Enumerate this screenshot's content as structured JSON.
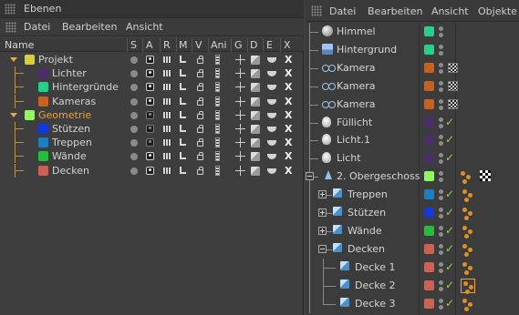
{
  "layers_window": {
    "title": "Ebenen",
    "menu": [
      "Datei",
      "Bearbeiten",
      "Ansicht"
    ],
    "columns": [
      "Name",
      "S",
      "A",
      "R",
      "M",
      "V",
      "Ani",
      "G",
      "D",
      "E",
      "X"
    ],
    "layers": [
      {
        "name": "Projekt",
        "color": "#d8d03a",
        "level": 0,
        "expanded": true,
        "solo": false
      },
      {
        "name": "Lichter",
        "color": "#4a2d6a",
        "level": 1
      },
      {
        "name": "Hintergründe",
        "color": "#22d28a",
        "level": 1
      },
      {
        "name": "Kameras",
        "color": "#c86020",
        "level": 1
      },
      {
        "name": "Geometrie",
        "color": "#8dff57",
        "level": 0,
        "expanded": true,
        "highlight": true
      },
      {
        "name": "Stützen",
        "color": "#1438e0",
        "level": 1
      },
      {
        "name": "Treppen",
        "color": "#1a80c4",
        "level": 1
      },
      {
        "name": "Wände",
        "color": "#22c03a",
        "level": 1
      },
      {
        "name": "Decken",
        "color": "#d06050",
        "level": 1
      }
    ]
  },
  "objects_window": {
    "menu": [
      "Datei",
      "Bearbeiten",
      "Ansicht",
      "Objekte"
    ],
    "objects": [
      {
        "name": "Himmel",
        "icon": "sky-icon",
        "layer_color": "#22d28a",
        "indent": 0
      },
      {
        "name": "Hintergrund",
        "icon": "background-icon",
        "layer_color": "#22d28a",
        "indent": 0
      },
      {
        "name": "Kamera",
        "icon": "camera-icon",
        "layer_color": "#c86020",
        "indent": 0,
        "tag": "target"
      },
      {
        "name": "Kamera",
        "icon": "camera-icon",
        "layer_color": "#c86020",
        "indent": 0,
        "tag": "target"
      },
      {
        "name": "Kamera",
        "icon": "camera-icon",
        "layer_color": "#c86020",
        "indent": 0,
        "tag": "target"
      },
      {
        "name": "Füllicht",
        "icon": "light-icon",
        "layer_color": "#4a2d6a",
        "indent": 0,
        "check": true
      },
      {
        "name": "Licht.1",
        "icon": "light-icon",
        "layer_color": "#4a2d6a",
        "indent": 0,
        "check": true
      },
      {
        "name": "Licht",
        "icon": "light-icon",
        "layer_color": "#4a2d6a",
        "indent": 0,
        "check": true
      },
      {
        "name": "2. Obergeschoss",
        "icon": "null-icon",
        "layer_color": "#8dff57",
        "indent": 0,
        "tag": "phong"
      },
      {
        "name": "Treppen",
        "icon": "cube-icon",
        "layer_color": "#1a80c4",
        "indent": 1,
        "check": true,
        "tag": "dots"
      },
      {
        "name": "Stützen",
        "icon": "cube-icon",
        "layer_color": "#1438e0",
        "indent": 1,
        "check": true,
        "tag": "dots"
      },
      {
        "name": "Wände",
        "icon": "cube-icon",
        "layer_color": "#22c03a",
        "indent": 1,
        "check": true,
        "tag": "dots"
      },
      {
        "name": "Decken",
        "icon": "cube-icon",
        "layer_color": "#d06050",
        "indent": 1,
        "check": true,
        "tag": "dots"
      },
      {
        "name": "Decke 1",
        "icon": "cube-icon",
        "layer_color": "#d06050",
        "indent": 2,
        "check": true,
        "tag": "dots"
      },
      {
        "name": "Decke 2",
        "icon": "cube-icon",
        "layer_color": "#d06050",
        "indent": 2,
        "check": true,
        "tag": "dots-selected"
      },
      {
        "name": "Decke 3",
        "icon": "cube-icon",
        "layer_color": "#d06050",
        "indent": 2,
        "check": true,
        "tag": "dots"
      }
    ]
  }
}
